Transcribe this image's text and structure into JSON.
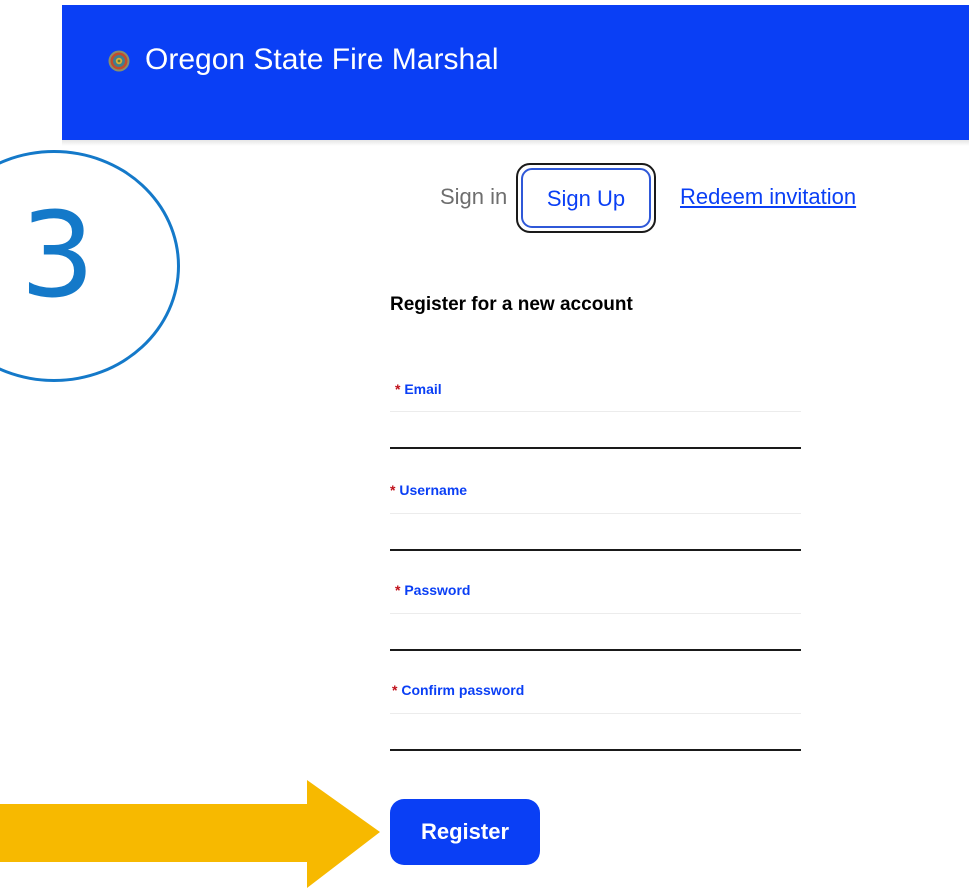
{
  "header": {
    "brand": "Oregon State Fire Marshal",
    "logo_icon": "seal-icon",
    "background_color": "#0a3ff5"
  },
  "annotation": {
    "step_number": "3",
    "circle_color": "#1479c9",
    "arrow_color": "#f7b900"
  },
  "tabs": {
    "sign_in": "Sign in",
    "sign_up": "Sign Up",
    "redeem": "Redeem invitation"
  },
  "form": {
    "heading": "Register for a new account",
    "required_mark": "*",
    "fields": [
      {
        "label": "Email",
        "value": ""
      },
      {
        "label": "Username",
        "value": ""
      },
      {
        "label": "Password",
        "value": ""
      },
      {
        "label": "Confirm password",
        "value": ""
      }
    ],
    "submit_label": "Register"
  }
}
